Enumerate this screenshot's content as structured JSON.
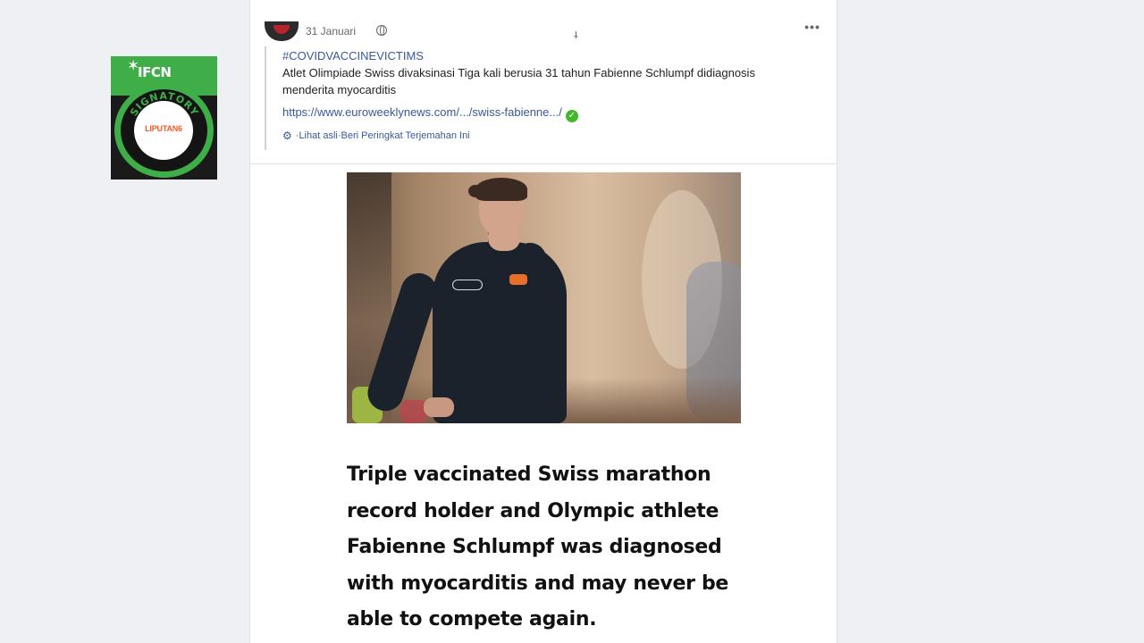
{
  "badge": {
    "brand": "IFCN",
    "ring_text": "SIGNATORY",
    "logo_text": "LIPUTAN6",
    "colors": {
      "green": "#3fae49",
      "dark": "#141414",
      "orange": "#f05a28"
    }
  },
  "post": {
    "date": "31 Januari",
    "more_label": "•••",
    "small_mark": "⸸",
    "hashtag": "#COVIDVACCINEVICTIMS",
    "text": "Atlet Olimpiade Swiss divaksinasi Tiga kali berusia 31 tahun Fabienne Schlumpf didiagnosis menderita myocarditis",
    "link": "https://www.euroweeklynews.com/.../swiss-fabienne.../",
    "translation": {
      "see_original": "Lihat asli",
      "separator": " · ",
      "rate_translation": "Beri Peringkat Terjemahan Ini"
    },
    "headline": "Triple vaccinated Swiss marathon record holder and Olympic athlete Fabienne Schlumpf was diagnosed with myocarditis and may never be able to compete again."
  },
  "icons": {
    "globe": "globe-icon",
    "verified": "verified-check-icon",
    "gear": "gear-icon",
    "more": "more-icon"
  },
  "colors": {
    "link": "#385898",
    "background": "#eef0f4",
    "verified": "#42b72a"
  }
}
